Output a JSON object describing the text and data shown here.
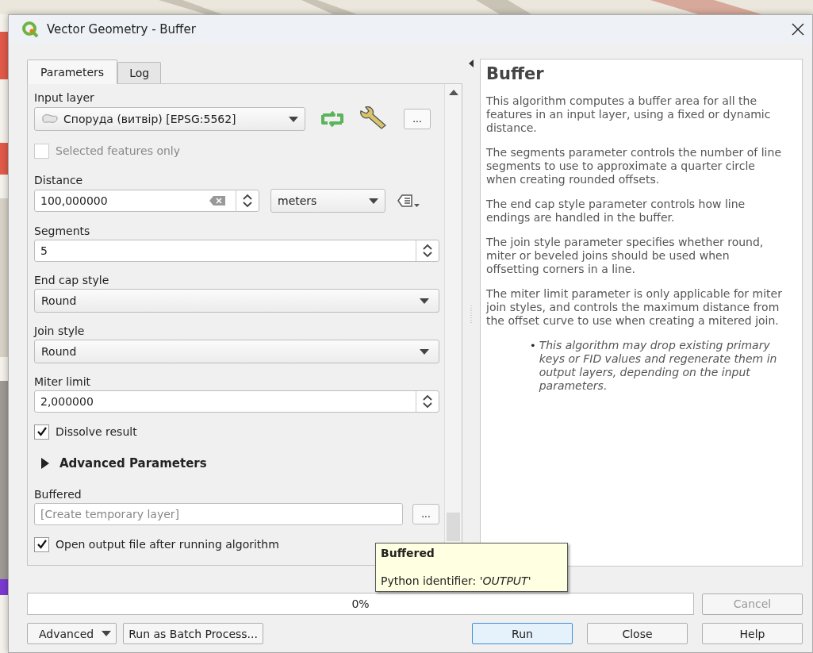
{
  "window": {
    "title": "Vector Geometry - Buffer"
  },
  "tabs": [
    {
      "label": "Parameters",
      "selected": true
    },
    {
      "label": "Log",
      "selected": false
    }
  ],
  "parameters": [
    {
      "kind": "layer",
      "label": "Input layer",
      "value": "Споруда (витвір) [EPSG:5562]",
      "button": "..."
    },
    {
      "kind": "checkbox",
      "label": "Selected features only",
      "checked": false,
      "disabled": true
    },
    {
      "kind": "distance",
      "label": "Distance",
      "value": "100,000000",
      "unit": "meters"
    },
    {
      "kind": "spin",
      "label": "Segments",
      "value": "5"
    },
    {
      "kind": "select",
      "label": "End cap style",
      "value": "Round"
    },
    {
      "kind": "select",
      "label": "Join style",
      "value": "Round"
    },
    {
      "kind": "spin",
      "label": "Miter limit",
      "value": "2,000000"
    },
    {
      "kind": "checkbox",
      "label": "Dissolve result",
      "checked": true,
      "disabled": false
    },
    {
      "kind": "section",
      "label": "Advanced Parameters",
      "expanded": false
    },
    {
      "kind": "output",
      "label": "Buffered",
      "placeholder": "[Create temporary layer]",
      "button": "..."
    },
    {
      "kind": "checkbox",
      "label": "Open output file after running algorithm",
      "checked": true,
      "disabled": false
    }
  ],
  "help": {
    "title": "Buffer",
    "paragraphs": [
      "This algorithm computes a buffer area for all the features in an input layer, using a fixed or dynamic distance.",
      "The segments parameter controls the number of line segments to use to approximate a quarter circle when creating rounded offsets.",
      "The end cap style parameter controls how line endings are handled in the buffer.",
      "The join style parameter specifies whether round, miter or beveled joins should be used when offsetting corners in a line.",
      "The miter limit parameter is only applicable for miter join styles, and controls the maximum distance from the offset curve to use when creating a mitered join."
    ],
    "notes": [
      {
        "marker": "•",
        "text": "This algorithm may drop existing primary keys or FID values and regenerate them in output layers, depending on the input parameters."
      }
    ]
  },
  "tooltip": {
    "title": "Buffered",
    "text": "Python identifier: *'OUTPUT'*"
  },
  "progress": {
    "level": 0,
    "label": "0%"
  },
  "cancel": {
    "label": "Cancel",
    "disabled": true
  },
  "left_buttons": [
    {
      "kind": "menu",
      "label": "Advanced"
    },
    {
      "kind": "plain",
      "label": "Run as Batch Process..."
    }
  ],
  "right_buttons": [
    {
      "label": "Run",
      "default": true
    },
    {
      "label": "Close",
      "default": false
    },
    {
      "label": "Help",
      "default": false
    }
  ]
}
